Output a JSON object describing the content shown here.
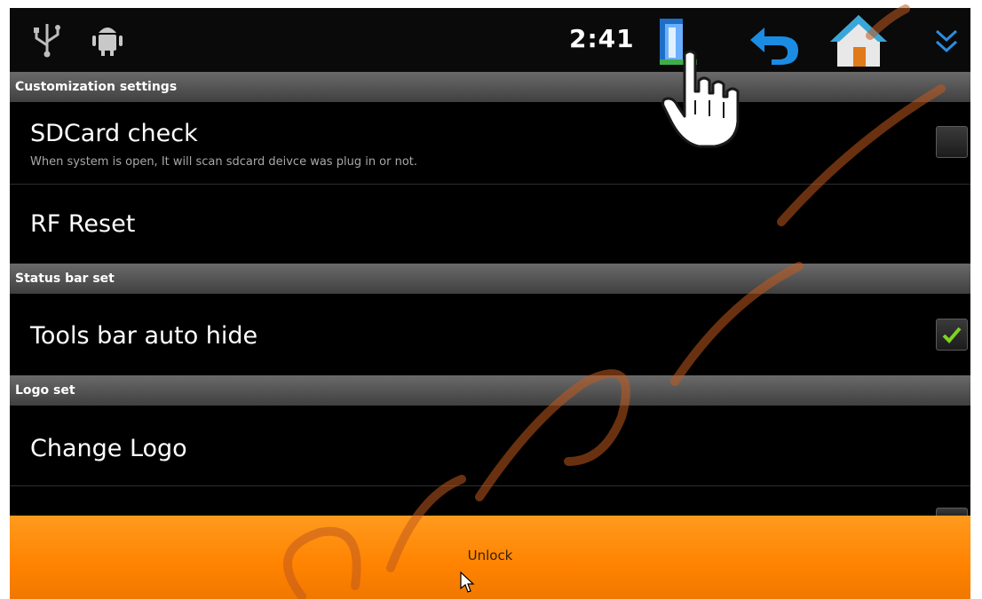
{
  "status_bar": {
    "time": "2:41",
    "icons": [
      "usb-icon",
      "android-debug-icon",
      "file-manager-icon",
      "back-icon",
      "home-icon",
      "collapse-icon"
    ]
  },
  "sections": {
    "customization": {
      "header": "Customization settings"
    },
    "status_bar_set": {
      "header": "Status bar set"
    },
    "logo_set": {
      "header": "Logo set"
    }
  },
  "settings": {
    "sdcard": {
      "title": "SDCard check",
      "subtitle": "When system is open, It will scan sdcard deivce was plug in or not.",
      "checked": false
    },
    "rf_reset": {
      "title": "RF Reset"
    },
    "tools_bar": {
      "title": "Tools bar auto hide",
      "checked": true
    },
    "change_logo": {
      "title": "Change Logo"
    }
  },
  "unlock": {
    "label": "Unlock"
  },
  "colors": {
    "accent": "#ff8a00",
    "check_green": "#7ed321",
    "header_gray": "#555555"
  }
}
